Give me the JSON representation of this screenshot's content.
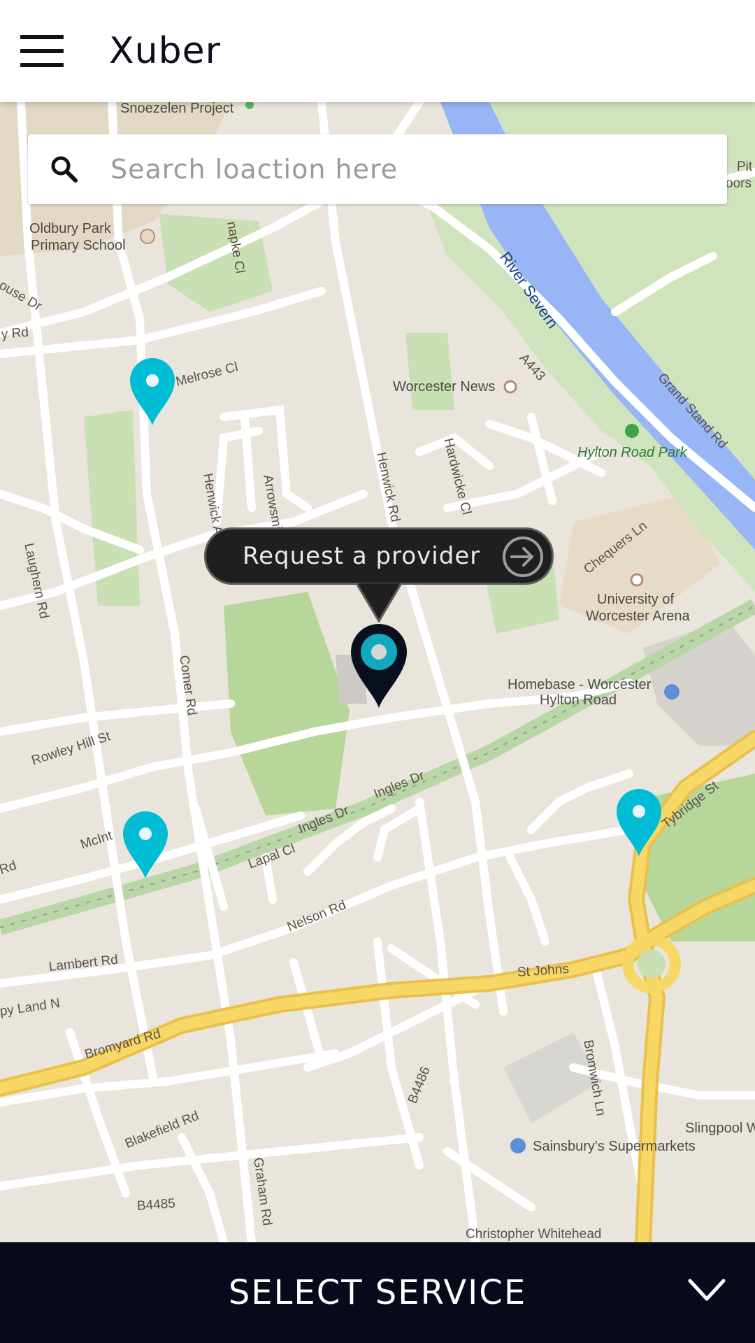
{
  "app": {
    "title": "Xuber"
  },
  "search": {
    "placeholder": "Search loaction here"
  },
  "map": {
    "labels": {
      "snoezelen": "Snoezelen Project",
      "oldbury1": "Oldbury Park",
      "oldbury2": "Primary School",
      "house_dr": "ouse Dr",
      "y_rd": "y Rd",
      "melrose": "Melrose Cl",
      "henwick_ave": "Henwick Ave",
      "arrowsmith": "Arrowsmith Ave",
      "henwick_rd": "Henwick Rd",
      "hardwicke": "Hardwicke Cl",
      "worcester_news": "Worcester News",
      "river": "River Severn",
      "a443": "A443",
      "grandstand": "Grand Stand Rd",
      "hylton_park": "Hylton Road Park",
      "chequers": "Chequers Ln",
      "uni1": "University of",
      "uni2": "Worcester Arena",
      "homebase1": "Homebase - Worcester",
      "homebase2": "Hylton Road",
      "laughern": "Laughern Rd",
      "comer": "Comer Rd",
      "rowley": "Rowley Hill St",
      "mcint": "McInt",
      "rd_left": "Rd",
      "ingles1": "Ingles Dr",
      "ingles2": "Ingles Dr",
      "lapal": "Lapal Cl",
      "tybridge": "Tybridge St",
      "nelson": "Nelson Rd",
      "lambert": "Lambert Rd",
      "py_land": "py Land N",
      "st_johns": "St Johns",
      "bromyard": "Bromyard Rd",
      "bromwich": "Bromwich Ln",
      "b4486": "B4486",
      "blakefield": "Blakefield Rd",
      "graham": "Graham Rd",
      "slingpool": "Slingpool W",
      "sainsburys": "Sainsbury's Supermarkets",
      "b4485": "B4485",
      "pit1": "Pit",
      "pit2": "oors",
      "knapke": "napke Cl",
      "christopher": "Christopher Whitehead"
    }
  },
  "tooltip": {
    "label": "Request a provider"
  },
  "bottom": {
    "label": "SELECT SERVICE"
  },
  "colors": {
    "accent": "#00bcd4",
    "selected_pin": "#0a0f1e",
    "bottom_bar": "#070a1a",
    "river": "#98b6f5",
    "major_road": "#f5cf4d",
    "park": "#c9dfb4"
  },
  "icons": [
    "menu-icon",
    "search-icon",
    "arrow-right-circle-icon",
    "chevron-down-icon",
    "map-pin-icon"
  ]
}
